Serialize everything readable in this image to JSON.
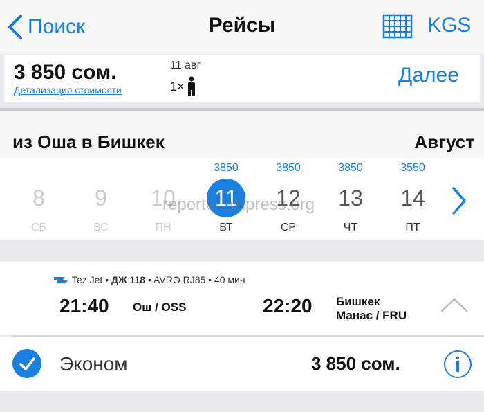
{
  "nav": {
    "back_label": "Поиск",
    "title": "Рейсы",
    "currency": "KGS"
  },
  "summary": {
    "price": "3 850 сом.",
    "price_details": "Детализация стоимости",
    "date": "11 авг",
    "passengers": "1×",
    "next_label": "Далее"
  },
  "route": {
    "title": "из Оша в Бишкек",
    "month": "Август"
  },
  "dates": [
    {
      "price": "",
      "day": "8",
      "weekday": "СБ"
    },
    {
      "price": "",
      "day": "9",
      "weekday": "ВС"
    },
    {
      "price": "",
      "day": "10",
      "weekday": "ПН"
    },
    {
      "price": "3850",
      "day": "11",
      "weekday": "ВТ"
    },
    {
      "price": "3850",
      "day": "12",
      "weekday": "СР"
    },
    {
      "price": "3850",
      "day": "13",
      "weekday": "ЧТ"
    },
    {
      "price": "3550",
      "day": "14",
      "weekday": "ПТ"
    }
  ],
  "watermark": "reporter.akipress.org",
  "flight": {
    "airline": "Tez Jet",
    "flight_no": "ДЖ 118",
    "aircraft_duration": "• AVRO RJ85 • 40 мин",
    "dep_time": "21:40",
    "dep_airport": "Ош / OSS",
    "arr_time": "22:20",
    "arr_city": "Бишкек",
    "arr_airport": "Манас / FRU"
  },
  "fare": {
    "class": "Эконом",
    "price": "3 850 сом."
  },
  "colors": {
    "accent": "#1a7fe0"
  }
}
